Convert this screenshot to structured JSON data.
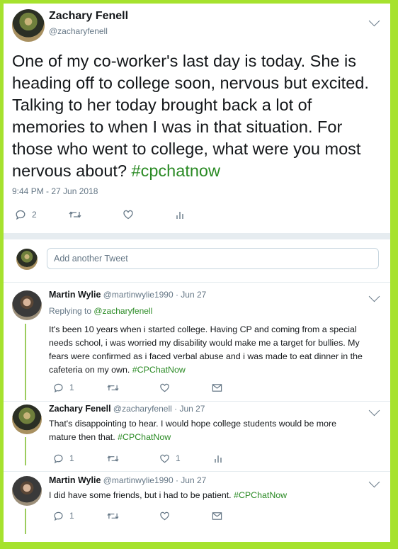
{
  "main_tweet": {
    "name": "Zachary Fenell",
    "handle": "@zacharyfenell",
    "text": "One of my co-worker's last day is today. She is heading off to college soon, nervous but excited. Talking to her today brought back a lot of memories to when I was in that situation. For those who went to college, what were you most nervous about? ",
    "hashtag": "#cpchatnow",
    "timestamp": "9:44 PM - 27 Jun 2018",
    "reply_count": "2",
    "icons": [
      "reply-icon",
      "retweet-icon",
      "like-icon",
      "analytics-icon"
    ]
  },
  "compose": {
    "placeholder": "Add another Tweet"
  },
  "replies": [
    {
      "name": "Martin Wylie",
      "handle_time": "@martinwylie1990 · Jun 27",
      "replying_prefix": "Replying to ",
      "replying_to": "@zacharyfenell",
      "lines": [
        "It's been 10 years when i started college. Having CP and coming from a special",
        "needs school, i was worried my disability would make me a target for bullies. My",
        "fears were confirmed as i faced verbal abuse and i was made to eat dinner in the",
        "cafeteria on my own. "
      ],
      "hashtag": "#CPChatNow",
      "reply_count": "1",
      "like_count": ""
    },
    {
      "name": "Zachary Fenell",
      "handle_time": "@zacharyfenell · Jun 27",
      "lines": [
        "That's disappointing to hear. I would hope college students would be more",
        "mature then that. "
      ],
      "hashtag": "#CPChatNow",
      "reply_count": "1",
      "like_count": "1"
    },
    {
      "name": "Martin Wylie",
      "handle_time": "@martinwylie1990 · Jun 27",
      "lines": [
        "I did have some friends, but i had to be patient. "
      ],
      "hashtag": "#CPChatNow",
      "reply_count": "1",
      "like_count": ""
    }
  ],
  "colors": {
    "border_green": "#a6e22e",
    "hashtag_green": "#2a8a24",
    "thread_line": "#9ccc5e",
    "muted_text": "#657786"
  }
}
